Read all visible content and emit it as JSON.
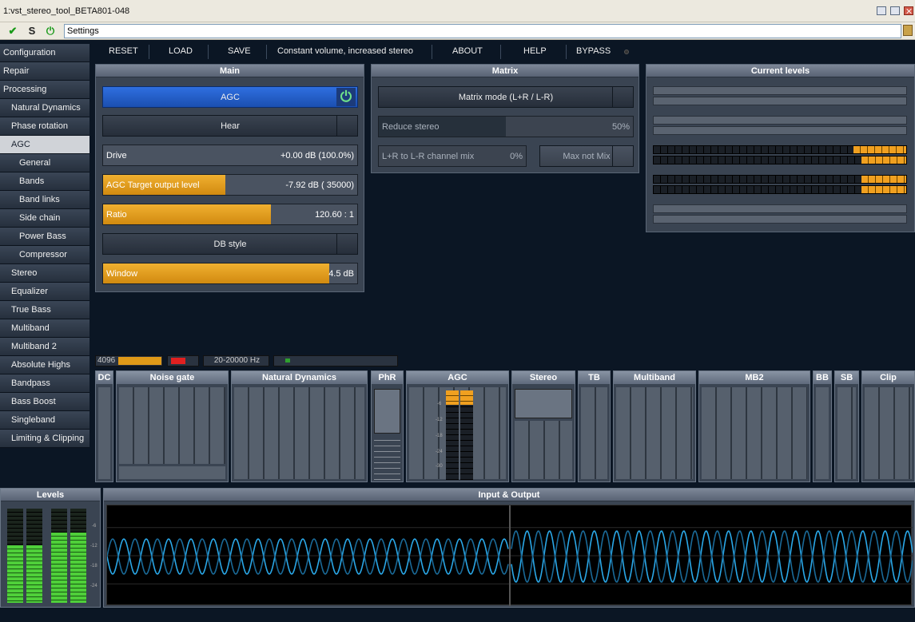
{
  "window": {
    "title": "1:vst_stereo_tool_BETA801-048"
  },
  "settings_bar": {
    "check_icon": "✔",
    "s_icon": "S",
    "power_icon": "⏻",
    "field_value": "Settings"
  },
  "sidebar": {
    "items": [
      {
        "label": "Configuration",
        "level": 0
      },
      {
        "label": "Repair",
        "level": 0
      },
      {
        "label": "Processing",
        "level": 0
      },
      {
        "label": "Natural Dynamics",
        "level": 1
      },
      {
        "label": "Phase rotation",
        "level": 1
      },
      {
        "label": "AGC",
        "level": 1,
        "active": true
      },
      {
        "label": "General",
        "level": 2
      },
      {
        "label": "Bands",
        "level": 2
      },
      {
        "label": "Band links",
        "level": 2
      },
      {
        "label": "Side chain",
        "level": 2
      },
      {
        "label": "Power Bass",
        "level": 2
      },
      {
        "label": "Compressor",
        "level": 2
      },
      {
        "label": "Stereo",
        "level": 1
      },
      {
        "label": "Equalizer",
        "level": 1
      },
      {
        "label": "True Bass",
        "level": 1
      },
      {
        "label": "Multiband",
        "level": 1
      },
      {
        "label": "Multiband 2",
        "level": 1
      },
      {
        "label": "Absolute Highs",
        "level": 1
      },
      {
        "label": "Bandpass",
        "level": 1
      },
      {
        "label": "Bass Boost",
        "level": 1
      },
      {
        "label": "Singleband",
        "level": 1
      },
      {
        "label": "Limiting & Clipping",
        "level": 1
      }
    ]
  },
  "toolbar": {
    "reset": "RESET",
    "load": "LOAD",
    "save": "SAVE",
    "preset": "Constant volume, increased stereo",
    "about": "ABOUT",
    "help": "HELP",
    "bypass": "BYPASS"
  },
  "main_panel": {
    "title": "Main",
    "agc_label": "AGC",
    "hear_label": "Hear",
    "drive": {
      "label": "Drive",
      "value": "+0.00 dB (100.0%)",
      "fill": 0
    },
    "target": {
      "label": "AGC Target output level",
      "value": "-7.92 dB ( 35000)",
      "fill": 0.48
    },
    "ratio": {
      "label": "Ratio",
      "value": "120.60 : 1",
      "fill": 0.66
    },
    "db_style_label": "DB style",
    "window": {
      "label": "Window",
      "value": "4.5 dB",
      "fill": 0.89
    }
  },
  "matrix_panel": {
    "title": "Matrix",
    "mode_label": "Matrix mode (L+R / L-R)",
    "reduce": {
      "label": "Reduce stereo",
      "value": "50%",
      "fill": 0.5
    },
    "mix": {
      "label": "L+R to L-R channel mix",
      "value": "0%"
    },
    "max_not_mix": "Max not Mix"
  },
  "levels_panel": {
    "title": "Current levels"
  },
  "status": {
    "buffer": "4096",
    "freq_range": "20-20000 Hz"
  },
  "modules": {
    "dc": "DC",
    "noise_gate": "Noise gate",
    "natural_dynamics": "Natural Dynamics",
    "phr": "PhR",
    "agc": "AGC",
    "stereo": "Stereo",
    "tb": "TB",
    "multiband": "Multiband",
    "mb2": "MB2",
    "bb": "BB",
    "sb": "SB",
    "clip": "Clip",
    "agc_ticks": [
      "-6",
      "-12",
      "-18",
      "-24",
      "-30"
    ]
  },
  "bottom": {
    "levels_title": "Levels",
    "io_title": "Input & Output",
    "level_ticks": [
      "-6",
      "-12",
      "-18",
      "-24"
    ]
  },
  "colors": {
    "accent_orange": "#e09a18",
    "agc_blue": "#2a64d8",
    "wave_blue": "#2aa8e8",
    "meter_green": "#4fcf3a"
  }
}
